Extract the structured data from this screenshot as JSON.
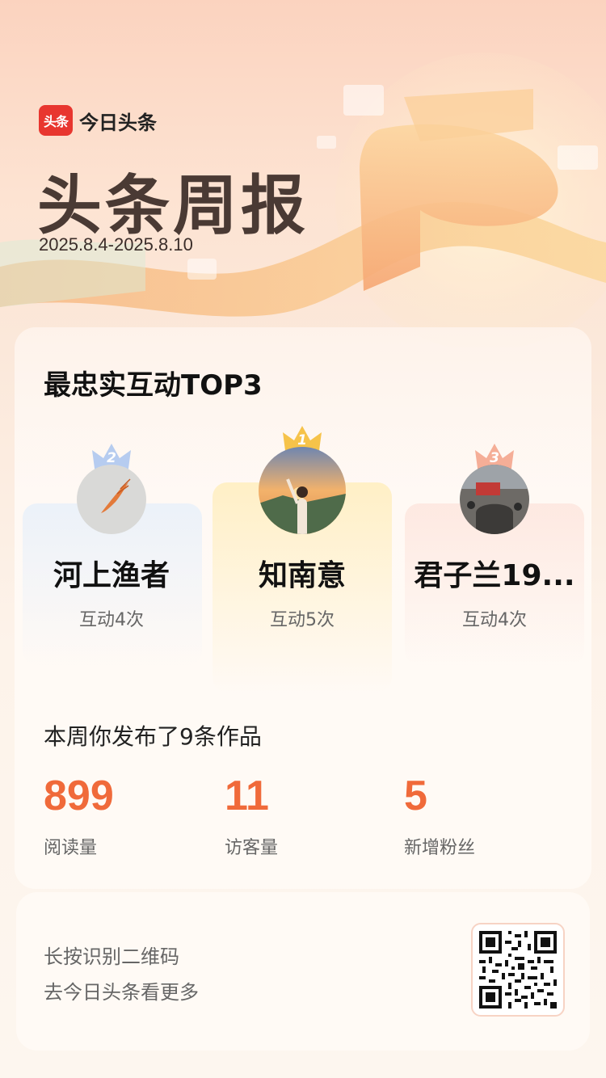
{
  "brand": {
    "logo_text": "头条",
    "app_name": "今日头条"
  },
  "header": {
    "title": "头条周报",
    "date_range": "2025.8.4-2025.8.10"
  },
  "interactions": {
    "title": "最忠实互动TOP3",
    "users": [
      {
        "rank": "2",
        "name": "河上渔者",
        "count": "互动4次"
      },
      {
        "rank": "1",
        "name": "知南意",
        "count": "互动5次"
      },
      {
        "rank": "3",
        "name": "君子兰19...",
        "count": "互动4次"
      }
    ]
  },
  "publish": {
    "summary": "本周你发布了9条作品",
    "stats": [
      {
        "value": "899",
        "label": "阅读量"
      },
      {
        "value": "11",
        "label": "访客量"
      },
      {
        "value": "5",
        "label": "新增粉丝"
      }
    ]
  },
  "footer": {
    "line1": "长按识别二维码",
    "line2": "去今日头条看更多"
  },
  "colors": {
    "accent": "#f06a3a",
    "brand_red": "#e8362f",
    "gold": "#f6c34a",
    "silver": "#a9c4ef",
    "bronze": "#f4a58d"
  }
}
